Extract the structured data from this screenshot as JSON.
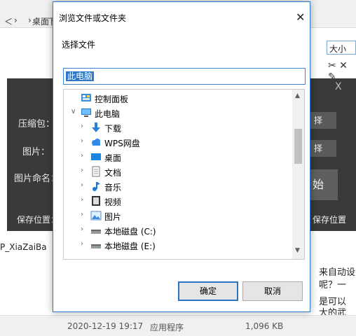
{
  "background": {
    "nav_left": "＜",
    "breadcrumb_arrow": "›",
    "breadcrumb_item": "桌面",
    "breadcrumb_next": "下",
    "sort_combo": "大小",
    "folder_name": "P_XiaZaiBa",
    "status": {
      "date": "2020-12-19 19:17",
      "type": "应用程序",
      "size": "1,096 KB"
    },
    "right_text": [
      "来自动设",
      "呢？一",
      "是可以",
      "大的武"
    ]
  },
  "app_panel": {
    "labels": [
      "压缩包：",
      "图片：",
      "图片命名：",
      "保存位置："
    ],
    "select_buttons": [
      "择",
      "择"
    ],
    "start_button": "始",
    "save_location_button": "保存位置",
    "close": "X"
  },
  "dialog": {
    "title": "浏览文件或文件夹",
    "close": "✕",
    "subtitle": "选择文件",
    "path_value": "此电脑",
    "ok": "确定",
    "cancel": "取消",
    "tree": [
      {
        "label": "控制面板",
        "icon": "control-panel-icon",
        "indent": 0,
        "expanded": null
      },
      {
        "label": "此电脑",
        "icon": "computer-icon",
        "indent": 0,
        "expanded": true
      },
      {
        "label": "下载",
        "icon": "download-icon",
        "indent": 1,
        "expanded": false
      },
      {
        "label": "WPS网盘",
        "icon": "cloud-icon",
        "indent": 1,
        "expanded": false
      },
      {
        "label": "桌面",
        "icon": "desktop-icon",
        "indent": 1,
        "expanded": false
      },
      {
        "label": "文档",
        "icon": "document-icon",
        "indent": 1,
        "expanded": false
      },
      {
        "label": "音乐",
        "icon": "music-icon",
        "indent": 1,
        "expanded": false
      },
      {
        "label": "视频",
        "icon": "video-icon",
        "indent": 1,
        "expanded": false
      },
      {
        "label": "图片",
        "icon": "picture-icon",
        "indent": 1,
        "expanded": false
      },
      {
        "label": "本地磁盘 (C:)",
        "icon": "drive-icon",
        "indent": 1,
        "expanded": false
      },
      {
        "label": "本地磁盘 (E:)",
        "icon": "drive-icon",
        "indent": 1,
        "expanded": false
      }
    ]
  }
}
